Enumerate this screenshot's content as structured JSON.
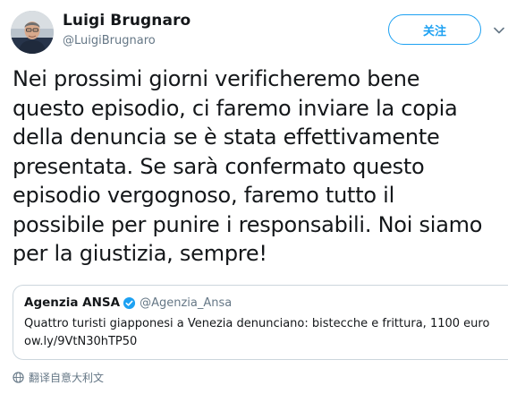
{
  "author": {
    "name": "Luigi Brugnaro",
    "handle": "@LuigiBrugnaro"
  },
  "follow_label": "关注",
  "tweet": {
    "lines": [
      "Nei prossimi giorni verificheremo bene",
      "questo episodio, ci faremo inviare la copia",
      "della denuncia se è stata effettivamente",
      "presentata. Se sarà confermato questo",
      "episodio vergognoso, faremo tutto il",
      "possibile per punire i responsabili. Noi siamo",
      "per la giustizia, sempre!"
    ]
  },
  "quote": {
    "name": "Agenzia ANSA",
    "handle": "@Agenzia_Ansa",
    "text": "Quattro turisti giapponesi a Venezia denunciano: bistecche e frittura, 1100 euro",
    "link": "ow.ly/9VtN30hTP50"
  },
  "translate_label": "翻译自意大利文",
  "colors": {
    "accent": "#1da1f2",
    "text": "#14171a",
    "secondary": "#657786",
    "border": "#ccd6dd"
  },
  "icons": {
    "caret": "chevron-down-icon",
    "verified": "verified-badge-icon",
    "translate": "globe-icon"
  }
}
